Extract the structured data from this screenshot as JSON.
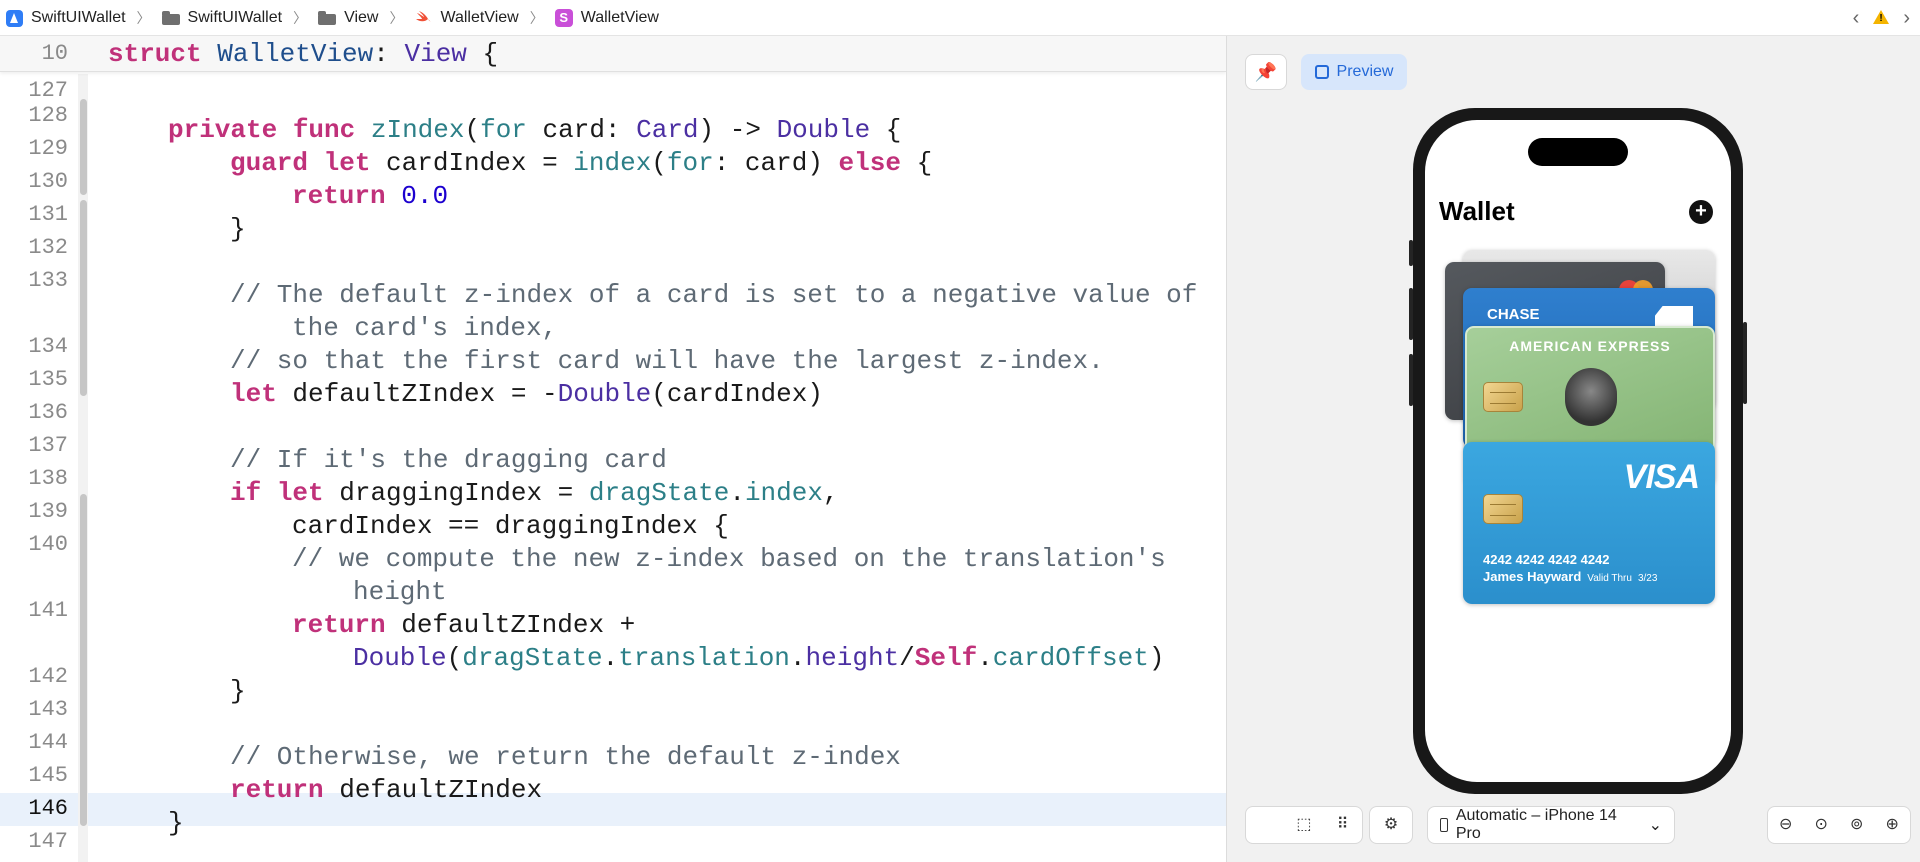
{
  "breadcrumb": {
    "project": "SwiftUIWallet",
    "group": "SwiftUIWallet",
    "folder": "View",
    "file": "WalletView",
    "symbol": "WalletView",
    "symbol_badge": "S"
  },
  "editor": {
    "sticky_line_number": "10",
    "sticky_code": "struct WalletView: View {",
    "line_numbers": [
      "127",
      "128",
      "129",
      "130",
      "131",
      "132",
      "133",
      "134",
      "135",
      "136",
      "137",
      "138",
      "139",
      "140",
      "141",
      "142",
      "143",
      "144",
      "145",
      "146",
      "147"
    ],
    "current_line": "146",
    "code": {
      "l128": {
        "kw1": "private",
        "kw2": "func",
        "name": "zIndex",
        "p1": "(",
        "p2": "for",
        "p3": " card: ",
        "t1": "Card",
        "p4": ") -> ",
        "t2": "Double",
        "p5": " {"
      },
      "l129": {
        "kw1": "guard",
        "kw2": "let",
        "p1": " cardIndex = ",
        "f1": "index",
        "p2": "(",
        "f2": "for",
        "p3": ": card) ",
        "kw3": "else",
        "p4": " {"
      },
      "l130": {
        "kw": "return",
        "num": "0.0"
      },
      "l131": "}",
      "l133a": "// The default z-index of a card is set to a negative value of",
      "l133b": "the card's index,",
      "l134": "// so that the first card will have the largest z-index.",
      "l135": {
        "kw": "let",
        "p1": " defaultZIndex = -",
        "t": "Double",
        "p2": "(cardIndex)"
      },
      "l137": "// If it's the dragging card",
      "l138": {
        "kw1": "if",
        "kw2": "let",
        "p1": " draggingIndex = ",
        "f1": "dragState",
        "p2": ".",
        "f2": "index",
        "p3": ","
      },
      "l139": "cardIndex == draggingIndex {",
      "l140a": "// we compute the new z-index based on the translation's",
      "l140b": "height",
      "l141": {
        "kw": "return",
        "p1": " defaultZIndex +"
      },
      "l141b": {
        "t": "Double",
        "p1": "(",
        "f1": "dragState",
        "p2": ".",
        "f2": "translation",
        "p3": ".",
        "t2": "height",
        "p4": "/",
        "kw": "Self",
        "p5": ".",
        "f3": "cardOffset",
        "p6": ")"
      },
      "l142": "}",
      "l144": "// Otherwise, we return the default z-index",
      "l145": {
        "kw": "return",
        "p1": " defaultZIndex"
      },
      "l146": "}"
    }
  },
  "canvas": {
    "preview_label": "Preview",
    "device_label": "Automatic – iPhone 14 Pro",
    "app": {
      "title": "Wallet",
      "cards": {
        "chase_name": "CHASE",
        "amex_name": "AMERICAN EXPRESS",
        "visa_logo": "VISA",
        "visa_number": "4242 4242 4242 4242",
        "visa_holder": "James Hayward",
        "visa_valid_label": "Valid Thru",
        "visa_valid_date": "3/23"
      }
    }
  },
  "colors": {
    "keyword": "#c0317a",
    "type": "#4b2fa2",
    "function": "#2c7f87",
    "number": "#1c00cf",
    "comment": "#5e6a75",
    "accent": "#2a7cf0"
  }
}
